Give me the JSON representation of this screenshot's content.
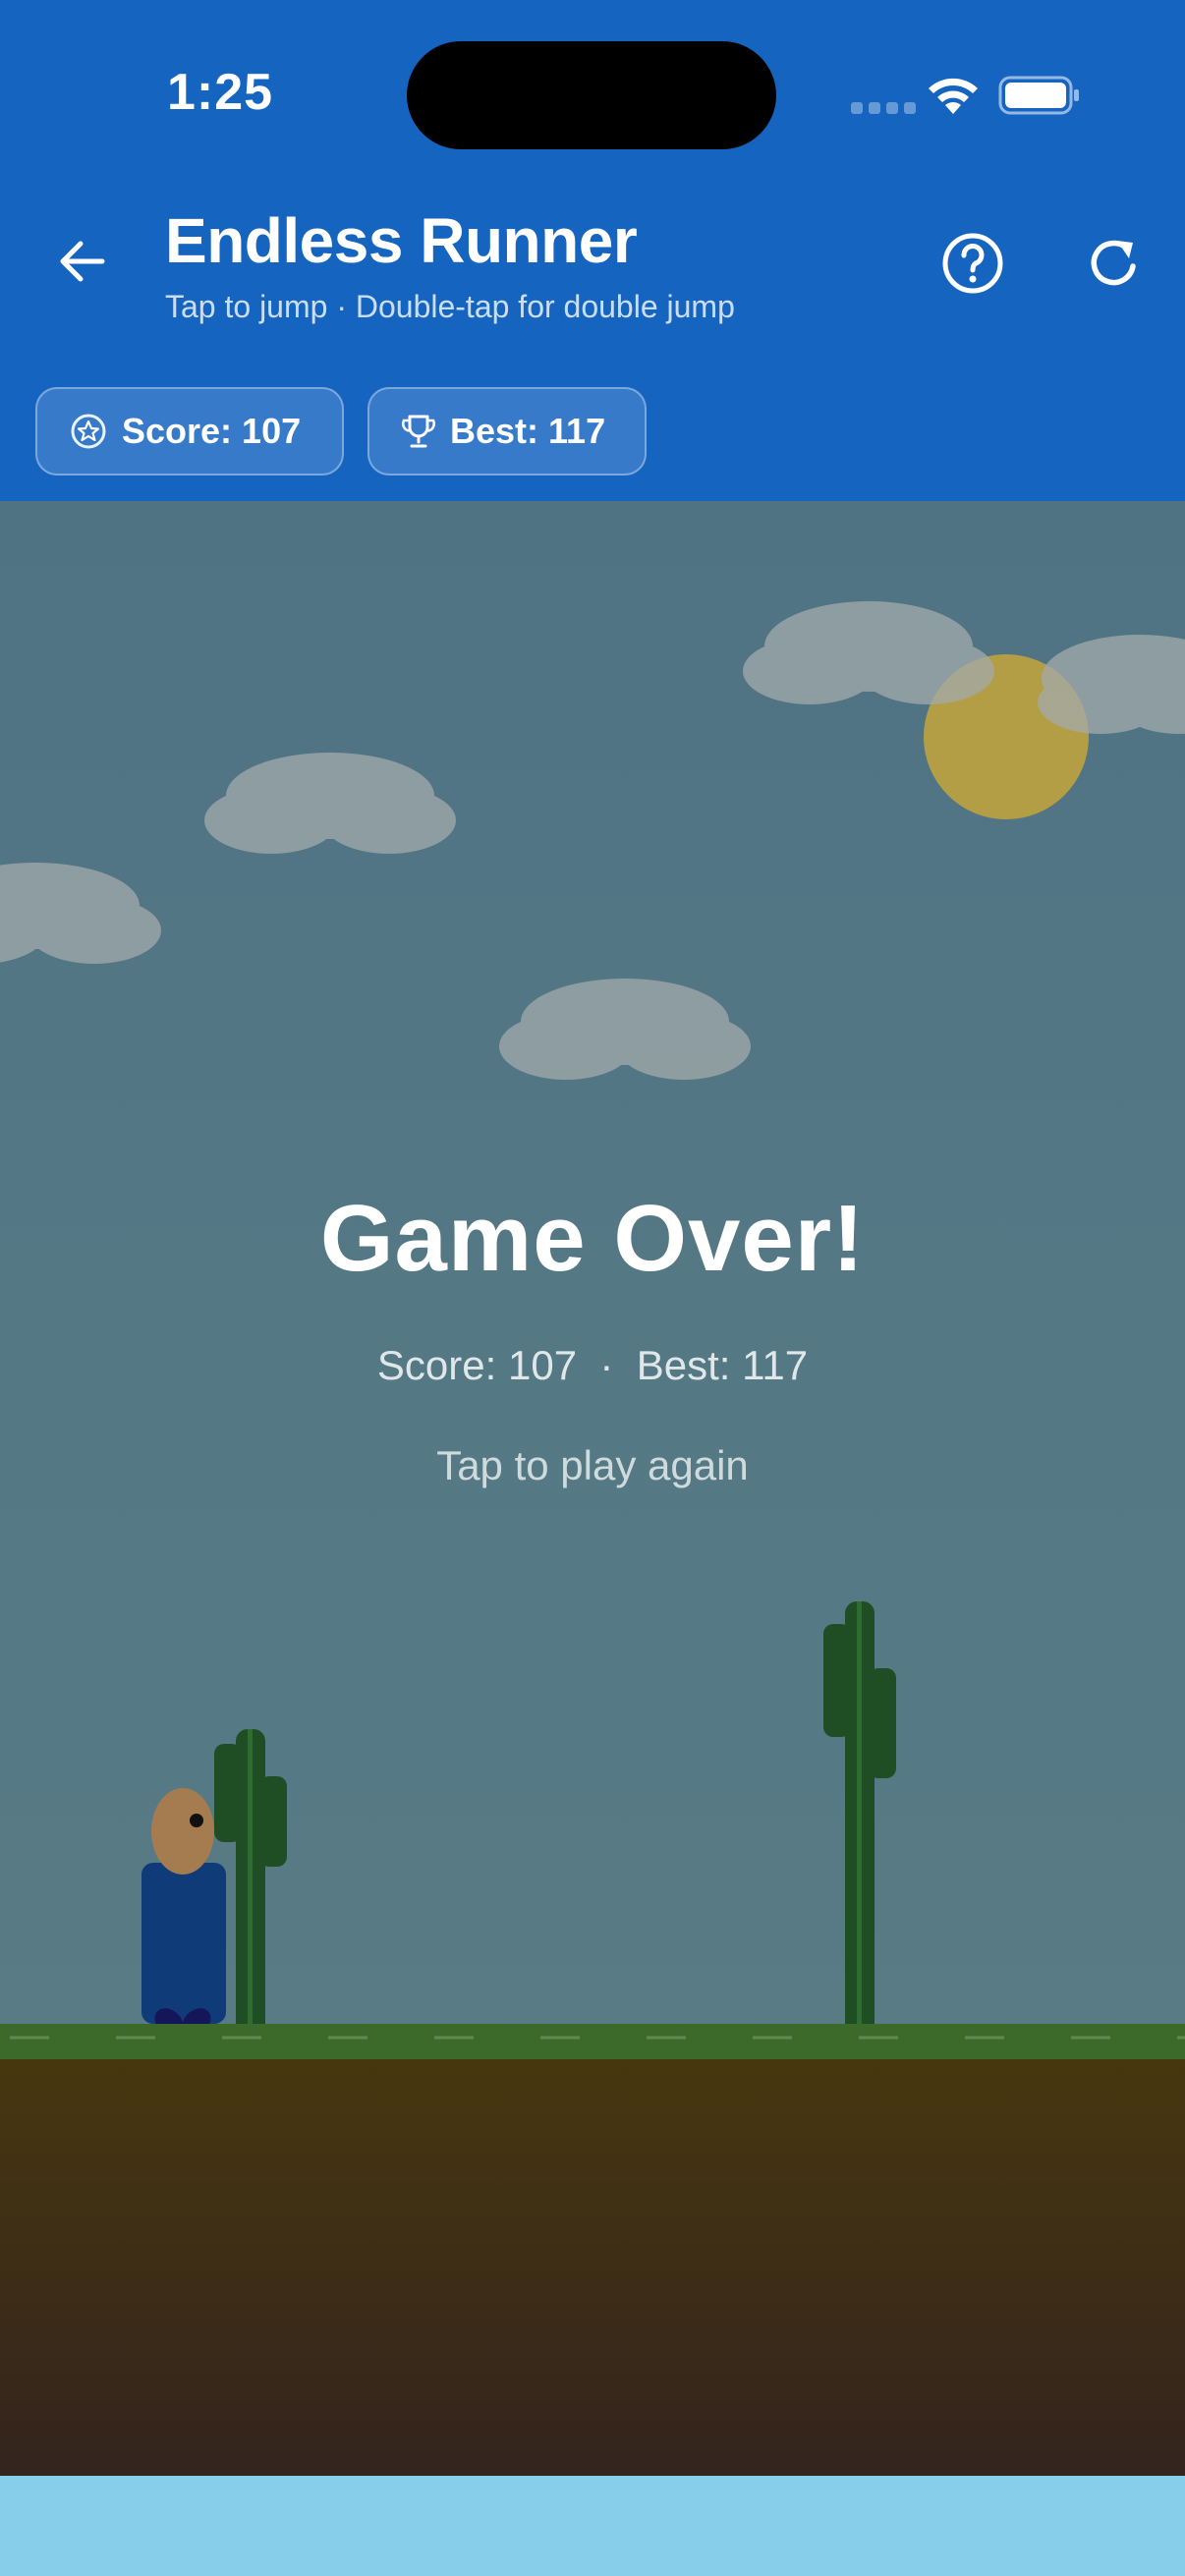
{
  "status_bar": {
    "time": "1:25"
  },
  "header": {
    "back_icon": "arrow-left-icon",
    "title": "Endless Runner",
    "subtitle": "Tap to jump · Double-tap for double jump",
    "help_icon": "help-circle-icon",
    "refresh_icon": "refresh-icon"
  },
  "chips": {
    "score_label": "Score: 107",
    "score_icon": "star-badge-icon",
    "best_label": "Best: 117",
    "best_icon": "trophy-icon"
  },
  "game_over": {
    "title": "Game Over!",
    "score_line": "Score: 107  ·  Best: 117",
    "prompt": "Tap to play again"
  },
  "scene": {
    "elements": [
      "sun",
      "clouds",
      "cacti",
      "player",
      "ground"
    ],
    "colors": {
      "header": "#1565c0",
      "sky": "#547886",
      "sun": "#c9a93b",
      "cloud": "#9aa5a6",
      "cactus": "#1f4f24",
      "grass": "#3b6b2a",
      "dirt": "#45360f",
      "player_body": "#0d3a7a",
      "player_head": "#a67c52",
      "player_feet": "#13135a"
    }
  }
}
